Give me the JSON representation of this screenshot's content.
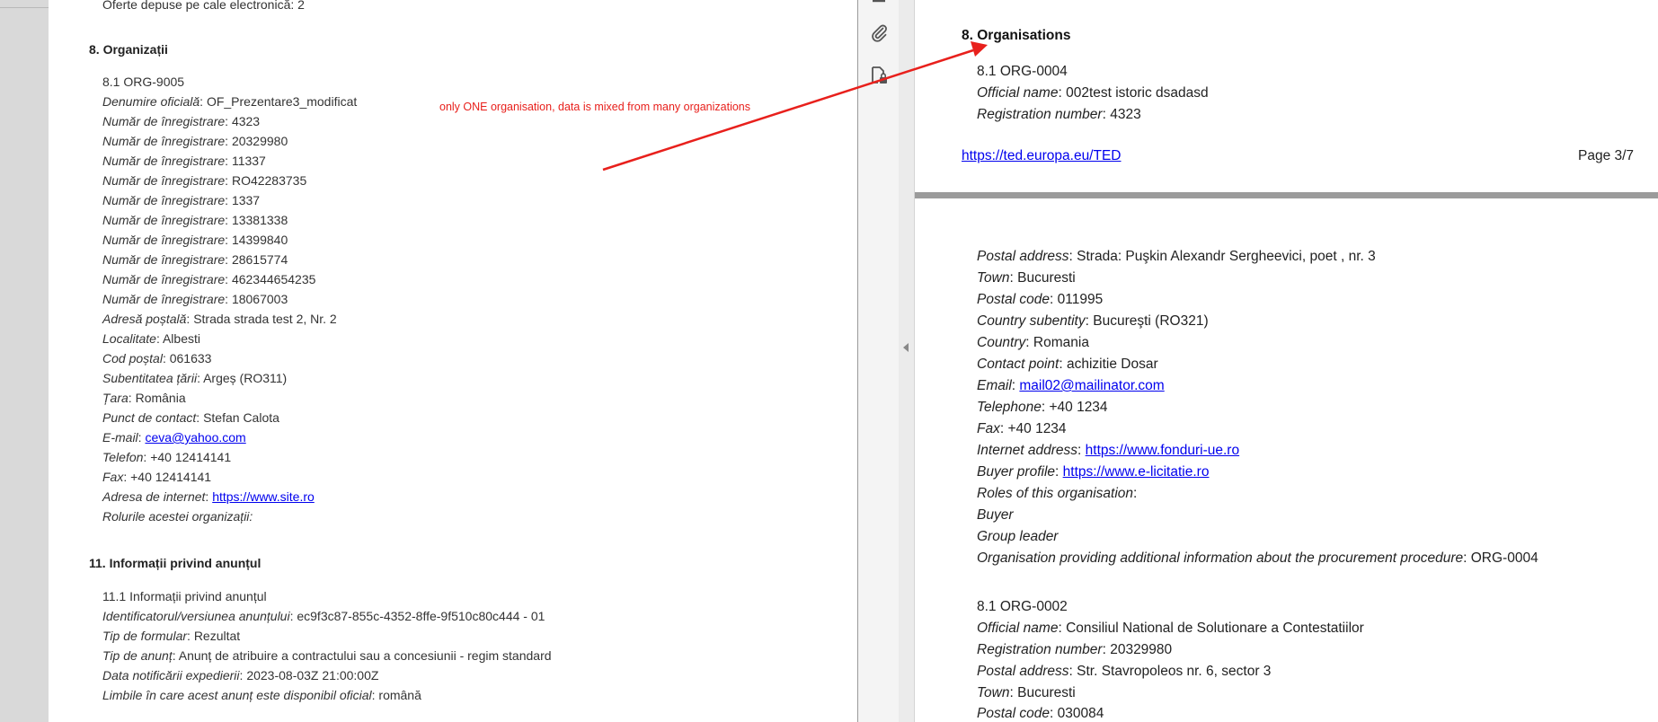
{
  "left": {
    "top_cut_line": "Oferte depuse pe cale electronică: 2",
    "section8": {
      "heading": "8. Organizații",
      "org_id": "8.1 ORG-9005",
      "official_name_label": "Denumire oficială",
      "official_name_value": "OF_Prezentare3_modificat",
      "reg_label": "Număr de înregistrare",
      "reg_values": [
        "4323",
        "20329980",
        "11337",
        "RO42283735",
        "1337",
        "13381338",
        "14399840",
        "28615774",
        "462344654235",
        "18067003"
      ],
      "postal_address_label": "Adresă poștală",
      "postal_address_value": "Strada strada test 2, Nr. 2",
      "town_label": "Localitate",
      "town_value": "Albesti",
      "postal_code_label": "Cod poștal",
      "postal_code_value": "061633",
      "subentity_label": "Subentitatea țării",
      "subentity_value": "Argeș (RO311)",
      "country_label": "Țara",
      "country_value": "România",
      "contact_label": "Punct de contact",
      "contact_value": "Stefan Calota",
      "email_label": "E-mail",
      "email_value": "ceva@yahoo.com",
      "phone_label": "Telefon",
      "phone_value": "+40 12414141",
      "fax_label": "Fax",
      "fax_value": "+40 12414141",
      "internet_label": "Adresa de internet",
      "internet_value": "https://www.site.ro",
      "roles_label": "Rolurile acestei organizații:"
    },
    "section11": {
      "heading": "11. Informații privind anunțul",
      "sub": "11.1 Informații privind anunțul",
      "id_label": "Identificatorul/versiunea anunțului",
      "id_value": "ec9f3c87-855c-4352-8ffe-9f510c80c444 - 01",
      "form_label": "Tip de formular",
      "form_value": "Rezultat",
      "notice_type_label": "Tip de anunț",
      "notice_type_value": "Anunț de atribuire a contractului sau a concesiunii - regim standard",
      "dispatch_label": "Data notificării expedierii",
      "dispatch_value": "2023-08-03Z 21:00:00Z",
      "languages_label": "Limbile în care acest anunț este disponibil oficial",
      "languages_value": "română"
    },
    "annotation": "only ONE organisation, data is mixed from many organizations"
  },
  "toolbar": {
    "icons": [
      "minus-icon",
      "paperclip-icon",
      "document-lock-icon"
    ]
  },
  "right": {
    "page1": {
      "heading": "8. Organisations",
      "org_id": "8.1 ORG-0004",
      "official_name_label": "Official name",
      "official_name_value": "002test istoric dsadasd",
      "reg_label": "Registration number",
      "reg_value": "4323",
      "footer_link": "https://ted.europa.eu/TED",
      "page_number": "Page 3/7"
    },
    "page2": {
      "postal_address_label": "Postal address",
      "postal_address_value": "Strada: Puşkin Alexandr Sergheevici, poet , nr. 3",
      "town_label": "Town",
      "town_value": "Bucuresti",
      "postal_code_label": "Postal code",
      "postal_code_value": "011995",
      "subentity_label": "Country subentity",
      "subentity_value": "Bucureşti (RO321)",
      "country_label": "Country",
      "country_value": "Romania",
      "contact_label": "Contact point",
      "contact_value": "achizitie Dosar",
      "email_label": "Email",
      "email_value": "mail02@mailinator.com",
      "phone_label": "Telephone",
      "phone_value": "+40 1234",
      "fax_label": "Fax",
      "fax_value": "+40 1234",
      "internet_label": "Internet address",
      "internet_value": "https://www.fonduri-ue.ro",
      "buyer_label": "Buyer profile",
      "buyer_value": "https://www.e-licitatie.ro",
      "roles_label": "Roles of this organisation",
      "role1": "Buyer",
      "role2": "Group leader",
      "addinfo_label": "Organisation providing additional information about the procurement procedure",
      "addinfo_value": "ORG-0004",
      "org2_id": "8.1 ORG-0002",
      "org2_name_label": "Official name",
      "org2_name_value": "Consiliul National de Solutionare a Contestatiilor",
      "org2_reg_label": "Registration number",
      "org2_reg_value": "20329980",
      "org2_postal_label": "Postal address",
      "org2_postal_value": "Str. Stavropoleos nr. 6, sector 3",
      "org2_town_label": "Town",
      "org2_town_value": "Bucuresti",
      "org2_code_label": "Postal code",
      "org2_code_value": "030084"
    }
  },
  "colors": {
    "annotation": "#e8201c",
    "link": "#0000ee"
  }
}
